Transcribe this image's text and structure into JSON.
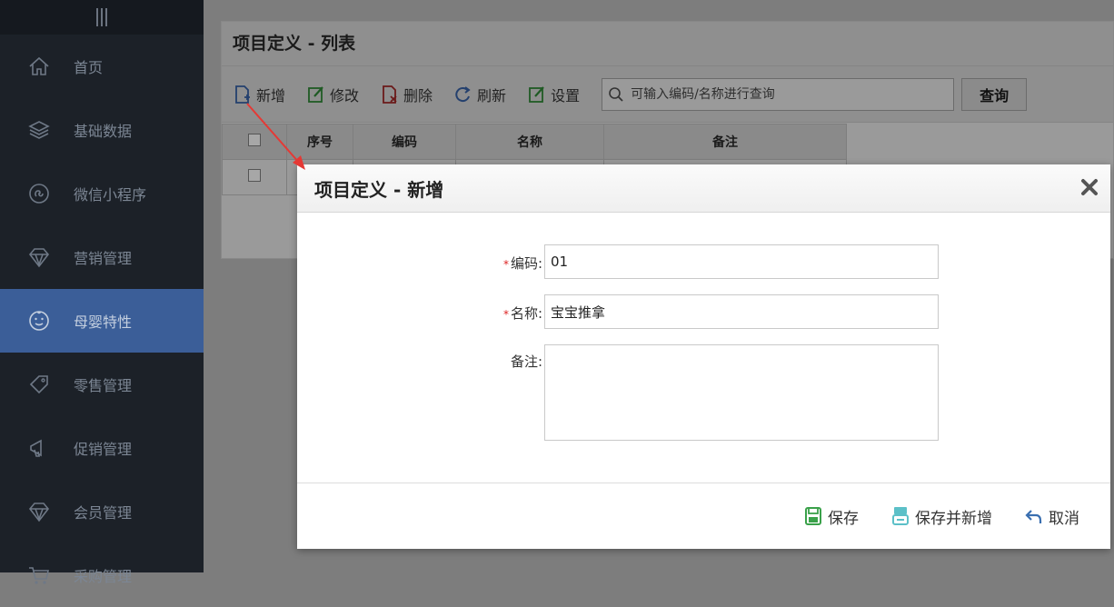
{
  "sidebar": {
    "items": [
      {
        "label": "首页",
        "icon": "home-icon",
        "active": false
      },
      {
        "label": "基础数据",
        "icon": "layers-icon",
        "active": false
      },
      {
        "label": "微信小程序",
        "icon": "wechat-icon",
        "active": false
      },
      {
        "label": "营销管理",
        "icon": "diamond-icon",
        "active": false
      },
      {
        "label": "母婴特性",
        "icon": "baby-face-icon",
        "active": true
      },
      {
        "label": "零售管理",
        "icon": "tag-icon",
        "active": false
      },
      {
        "label": "促销管理",
        "icon": "megaphone-icon",
        "active": false
      },
      {
        "label": "会员管理",
        "icon": "diamond-icon",
        "active": false
      },
      {
        "label": "采购管理",
        "icon": "cart-icon",
        "active": false
      }
    ]
  },
  "list": {
    "title": "项目定义 - 列表",
    "toolbar": {
      "add": "新增",
      "edit": "修改",
      "delete": "删除",
      "refresh": "刷新",
      "settings": "设置",
      "search_placeholder": "可输入编码/名称进行查询",
      "query": "查询"
    },
    "columns": [
      "序号",
      "编码",
      "名称",
      "备注"
    ]
  },
  "dialog": {
    "title": "项目定义 - 新增",
    "fields": {
      "code_label": "编码:",
      "code_value": "01",
      "name_label": "名称:",
      "name_value": "宝宝推拿",
      "remark_label": "备注:",
      "remark_value": ""
    },
    "required_mark": "*",
    "buttons": {
      "save": "保存",
      "save_new": "保存并新增",
      "cancel": "取消"
    }
  },
  "colors": {
    "accent": "#3b5e98",
    "sidebar_bg": "#1c2128",
    "arrow": "#e53935",
    "save_green": "#3aa14a",
    "save_new_teal": "#5cc0c8",
    "cancel_blue": "#3a6fb0"
  }
}
